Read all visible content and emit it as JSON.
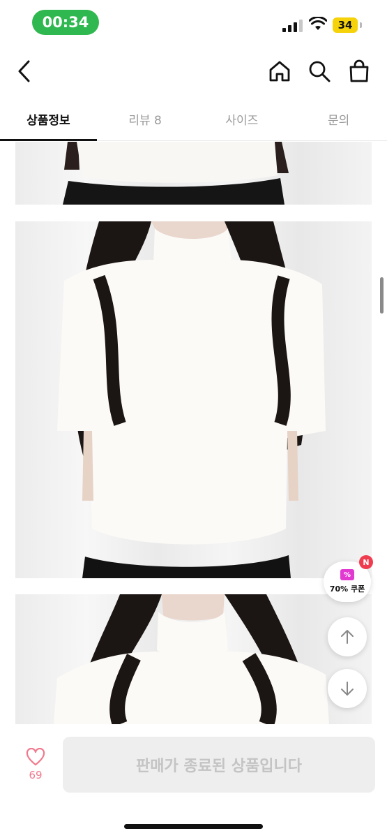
{
  "status_bar": {
    "time": "00:34",
    "battery": "34"
  },
  "nav": {
    "back_icon": "chevron-left-icon",
    "home_icon": "home-icon",
    "search_icon": "search-icon",
    "bag_icon": "shopping-bag-icon"
  },
  "tabs": [
    {
      "label": "상품정보",
      "active": true
    },
    {
      "label": "리뷰 8",
      "active": false
    },
    {
      "label": "사이즈",
      "active": false
    },
    {
      "label": "문의",
      "active": false
    }
  ],
  "floating": {
    "coupon_label": "70% 쿠폰",
    "coupon_icon_text": "%",
    "new_badge": "N"
  },
  "bottom": {
    "like_count": "69",
    "sold_out_label": "판매가 종료된 상품입니다"
  },
  "colors": {
    "time_pill": "#2fb84f",
    "battery": "#f5d20a",
    "like": "#f07a8e",
    "coupon": "#e23ad1",
    "badge": "#ef3d4f"
  }
}
